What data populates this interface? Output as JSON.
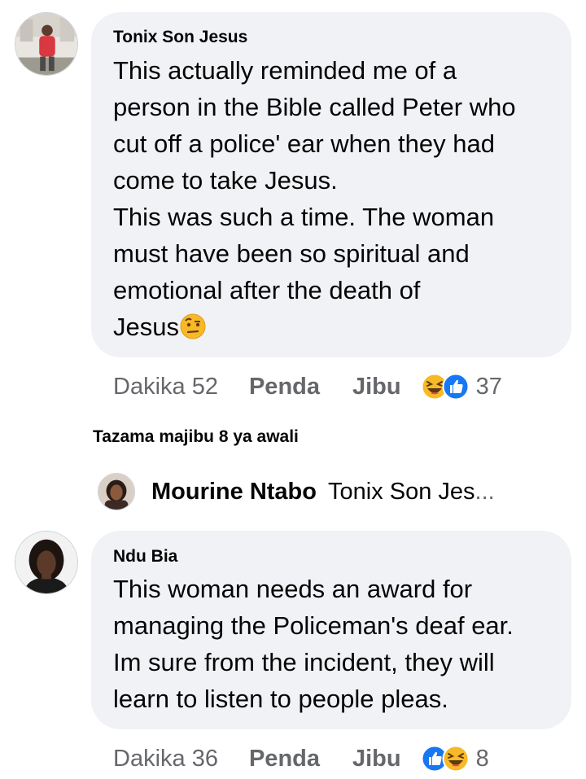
{
  "comments": [
    {
      "author": "Tonix Son Jesus",
      "text": "This actually reminded me of a\nperson in the Bible called Peter who\ncut off a police' ear when they had\ncome to take Jesus.\nThis was such a time. The woman\nmust have been so spiritual and\nemotional after the death of\nJesus",
      "trailing_emoji": "face-with-raised-eyebrow-emoji",
      "time": "Dakika 52",
      "like_label": "Penda",
      "reply_label": "Jibu",
      "reactions": [
        "haha-icon",
        "like-icon"
      ],
      "reaction_count": "37"
    },
    {
      "author": "Ndu Bia",
      "text": "This woman needs an award for\nmanaging the Policeman's deaf ear.\nIm sure from the incident, they will\nlearn to  listen to people pleas.",
      "time": "Dakika 36",
      "like_label": "Penda",
      "reply_label": "Jibu",
      "reactions": [
        "like-icon",
        "haha-icon"
      ],
      "reaction_count": "8"
    }
  ],
  "view_previous_replies": "Tazama majibu 8 ya awali",
  "reply_preview": {
    "author": "Mourine Ntabo",
    "snippet": "Tonix Son Jes",
    "ellipsis": "..."
  },
  "colors": {
    "bubble": "#f0f2f5",
    "meta_text": "#65676b",
    "like_blue": "#1877f2",
    "haha_yellow": "#f7b928"
  }
}
